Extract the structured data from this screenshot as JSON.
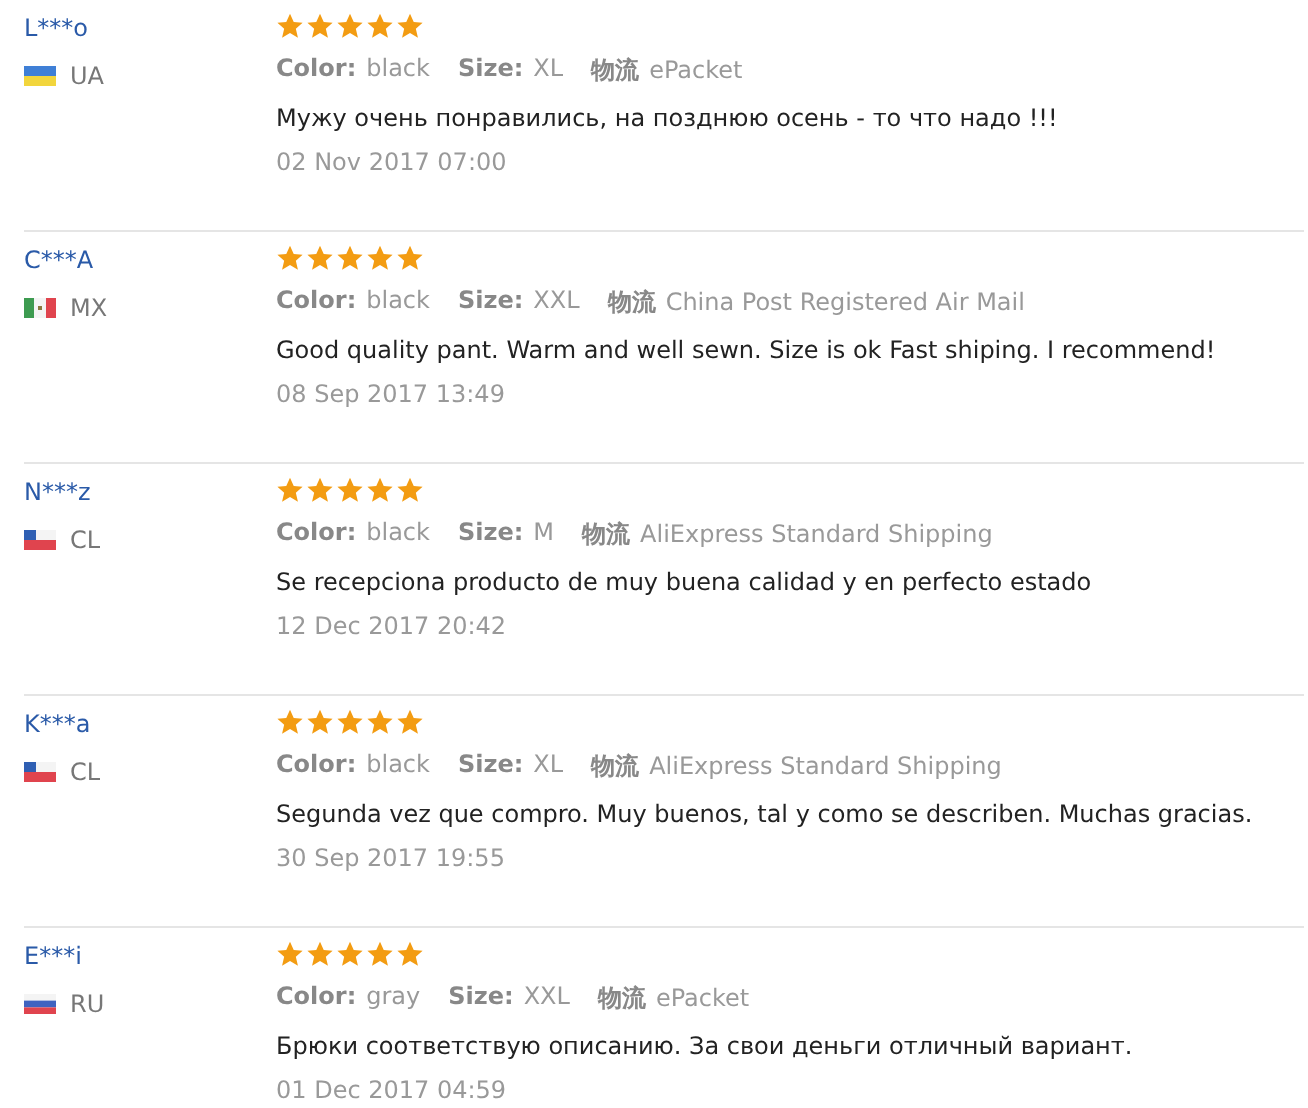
{
  "reviews": [
    {
      "user": "L***o",
      "flag": {
        "kind": "ua"
      },
      "country": "UA",
      "stars": 5,
      "color_label": "Color:",
      "color_value": "black",
      "size_label": "Size:",
      "size": "XL",
      "shipping_label": "物流",
      "shipping": "ePacket",
      "text": "Мужу очень понравились, на позднюю осень - то что надо !!!",
      "date": "02 Nov 2017 07:00"
    },
    {
      "user": "C***A",
      "flag": {
        "kind": "mx"
      },
      "country": "MX",
      "stars": 5,
      "color_label": "Color:",
      "color_value": "black",
      "size_label": "Size:",
      "size": "XXL",
      "shipping_label": "物流",
      "shipping": "China Post Registered Air Mail",
      "text": "Good quality pant. Warm and well sewn. Size is ok Fast shiping. I recommend!",
      "date": "08 Sep 2017 13:49"
    },
    {
      "user": "N***z",
      "flag": {
        "kind": "cl"
      },
      "country": "CL",
      "stars": 5,
      "color_label": "Color:",
      "color_value": "black",
      "size_label": "Size:",
      "size": "M",
      "shipping_label": "物流",
      "shipping": "AliExpress Standard Shipping",
      "text": "Se recepciona producto de muy buena calidad y en perfecto estado",
      "date": "12 Dec 2017 20:42"
    },
    {
      "user": "K***a",
      "flag": {
        "kind": "cl"
      },
      "country": "CL",
      "stars": 5,
      "color_label": "Color:",
      "color_value": "black",
      "size_label": "Size:",
      "size": "XL",
      "shipping_label": "物流",
      "shipping": "AliExpress Standard Shipping",
      "text": "Segunda vez que compro. Muy buenos, tal y como se describen. Muchas gracias.",
      "date": "30 Sep 2017 19:55"
    },
    {
      "user": "E***i",
      "flag": {
        "kind": "ru"
      },
      "country": "RU",
      "stars": 5,
      "color_label": "Color:",
      "color_value": "gray",
      "size_label": "Size:",
      "size": "XXL",
      "shipping_label": "物流",
      "shipping": "ePacket",
      "text": "Брюки соответствую описанию. За свои деньги отличный вариант.",
      "date": "01 Dec 2017 04:59"
    }
  ]
}
